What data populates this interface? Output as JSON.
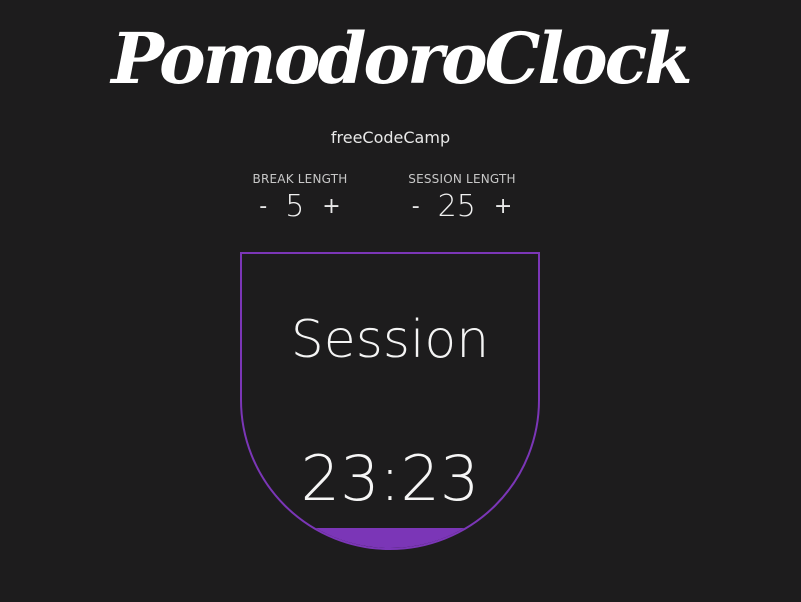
{
  "header": {
    "title": "PomodoroClock",
    "subtitle": "freeCodeCamp"
  },
  "break_control": {
    "label": "BREAK LENGTH",
    "minus": "-",
    "value": "5",
    "plus": "+"
  },
  "session_control": {
    "label": "SESSION LENGTH",
    "minus": "-",
    "value": "25",
    "plus": "+"
  },
  "timer": {
    "mode": "Session",
    "time": "23:23",
    "progress_fraction": 0.068,
    "fill_color": "#7b36b7",
    "border_color": "#7b36b7"
  }
}
